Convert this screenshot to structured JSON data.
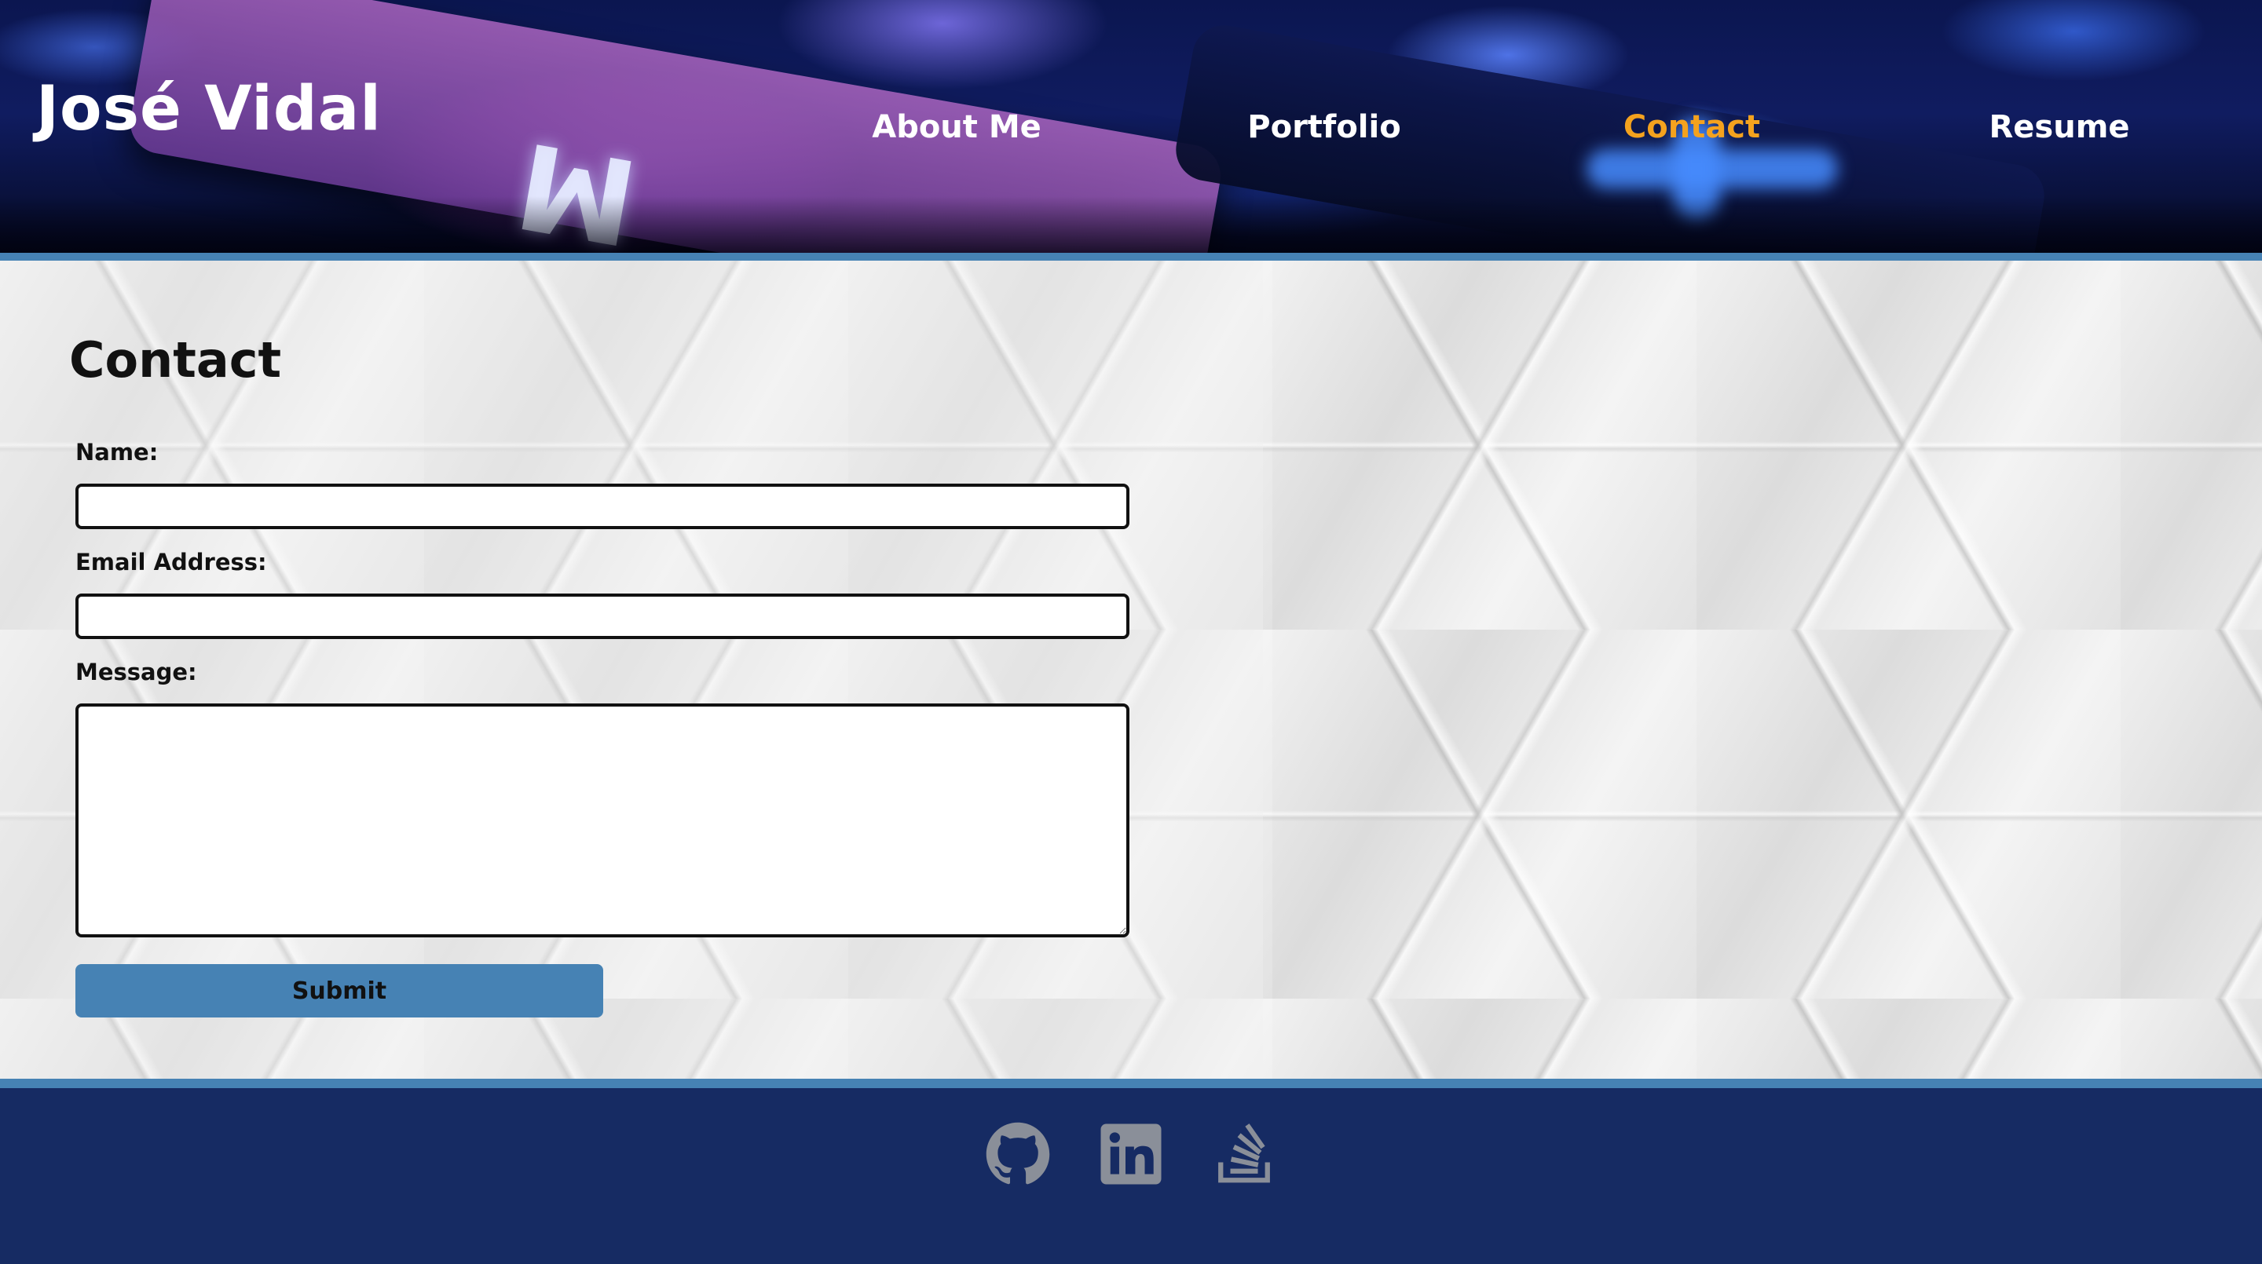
{
  "header": {
    "site_title": "José Vidal",
    "nav": [
      {
        "label": "About Me",
        "active": false
      },
      {
        "label": "Portfolio",
        "active": false
      },
      {
        "label": "Contact",
        "active": true
      },
      {
        "label": "Resume",
        "active": false
      }
    ],
    "active_color": "#f4a21e"
  },
  "contact": {
    "heading": "Contact",
    "name_label": "Name:",
    "name_value": "",
    "email_label": "Email Address:",
    "email_value": "",
    "message_label": "Message:",
    "message_value": "",
    "submit_label": "Submit"
  },
  "footer": {
    "links": [
      {
        "icon": "github-icon"
      },
      {
        "icon": "linkedin-icon"
      },
      {
        "icon": "stackoverflow-icon"
      }
    ]
  },
  "colors": {
    "accent": "#4682b4",
    "footer_bg": "#162b63",
    "icon": "#8a8f99"
  }
}
